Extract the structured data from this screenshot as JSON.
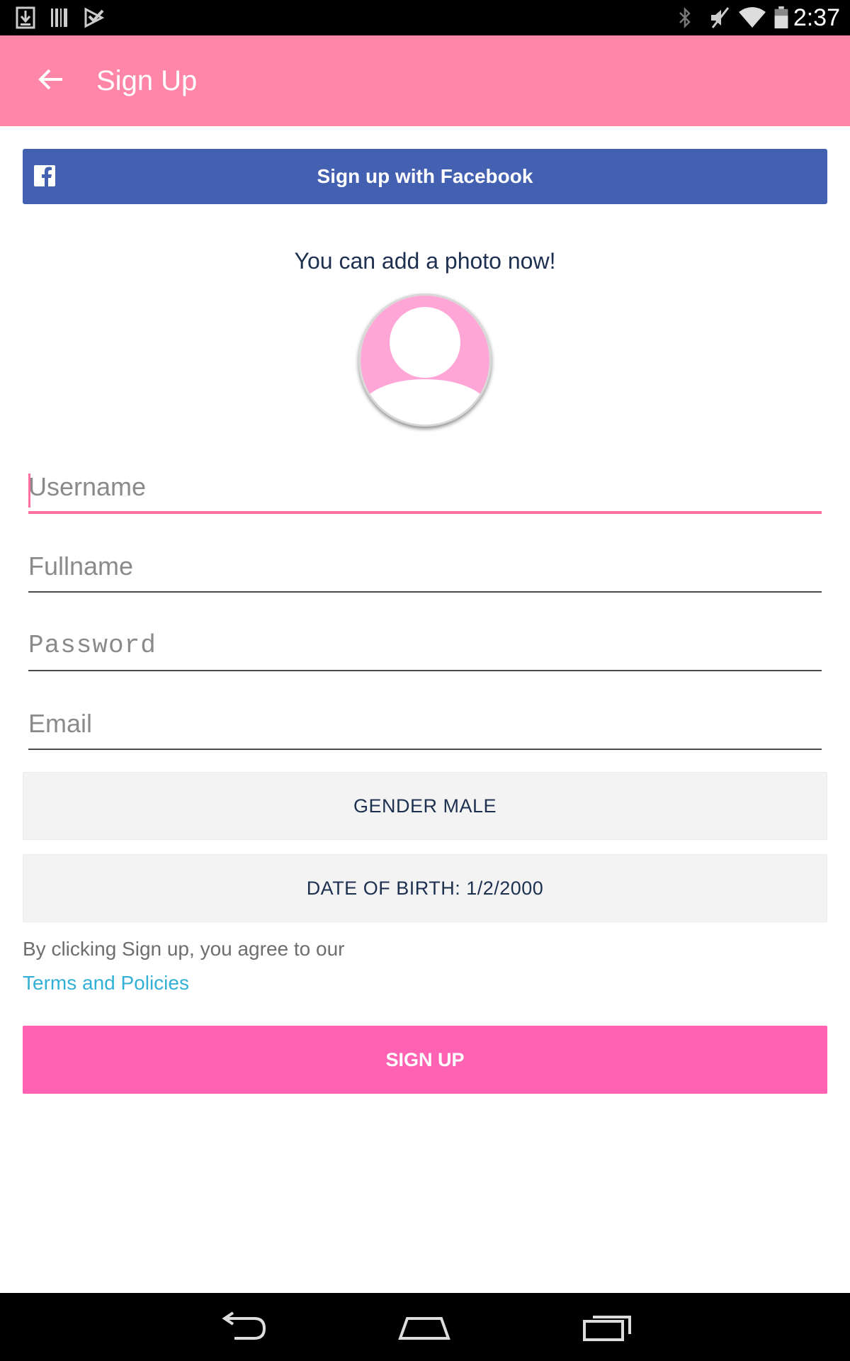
{
  "status_bar": {
    "time": "2:37"
  },
  "app_bar": {
    "title": "Sign Up"
  },
  "facebook": {
    "label": "Sign up with Facebook"
  },
  "photo": {
    "prompt": "You can add a photo now!"
  },
  "form": {
    "username": {
      "placeholder": "Username",
      "value": ""
    },
    "fullname": {
      "placeholder": "Fullname",
      "value": ""
    },
    "password": {
      "placeholder": "Password",
      "value": ""
    },
    "email": {
      "placeholder": "Email",
      "value": ""
    }
  },
  "gender": {
    "label": "GENDER MALE"
  },
  "dob": {
    "label": "DATE OF BIRTH: 1/2/2000"
  },
  "agreement": {
    "text": "By clicking Sign up, you agree to our",
    "link": "Terms and Policies"
  },
  "signup": {
    "label": "SIGN UP"
  },
  "colors": {
    "app_bar": "#ff86a6",
    "facebook": "#4460b1",
    "signup": "#ff62b3",
    "link": "#33b0d6",
    "focus": "#ff6fa0"
  },
  "icons": {
    "status": [
      "download-icon",
      "barcode-icon",
      "play-store-icon",
      "bluetooth-icon",
      "mute-icon",
      "wifi-icon",
      "battery-icon"
    ],
    "nav": [
      "nav-back-icon",
      "nav-home-icon",
      "nav-recents-icon"
    ]
  }
}
